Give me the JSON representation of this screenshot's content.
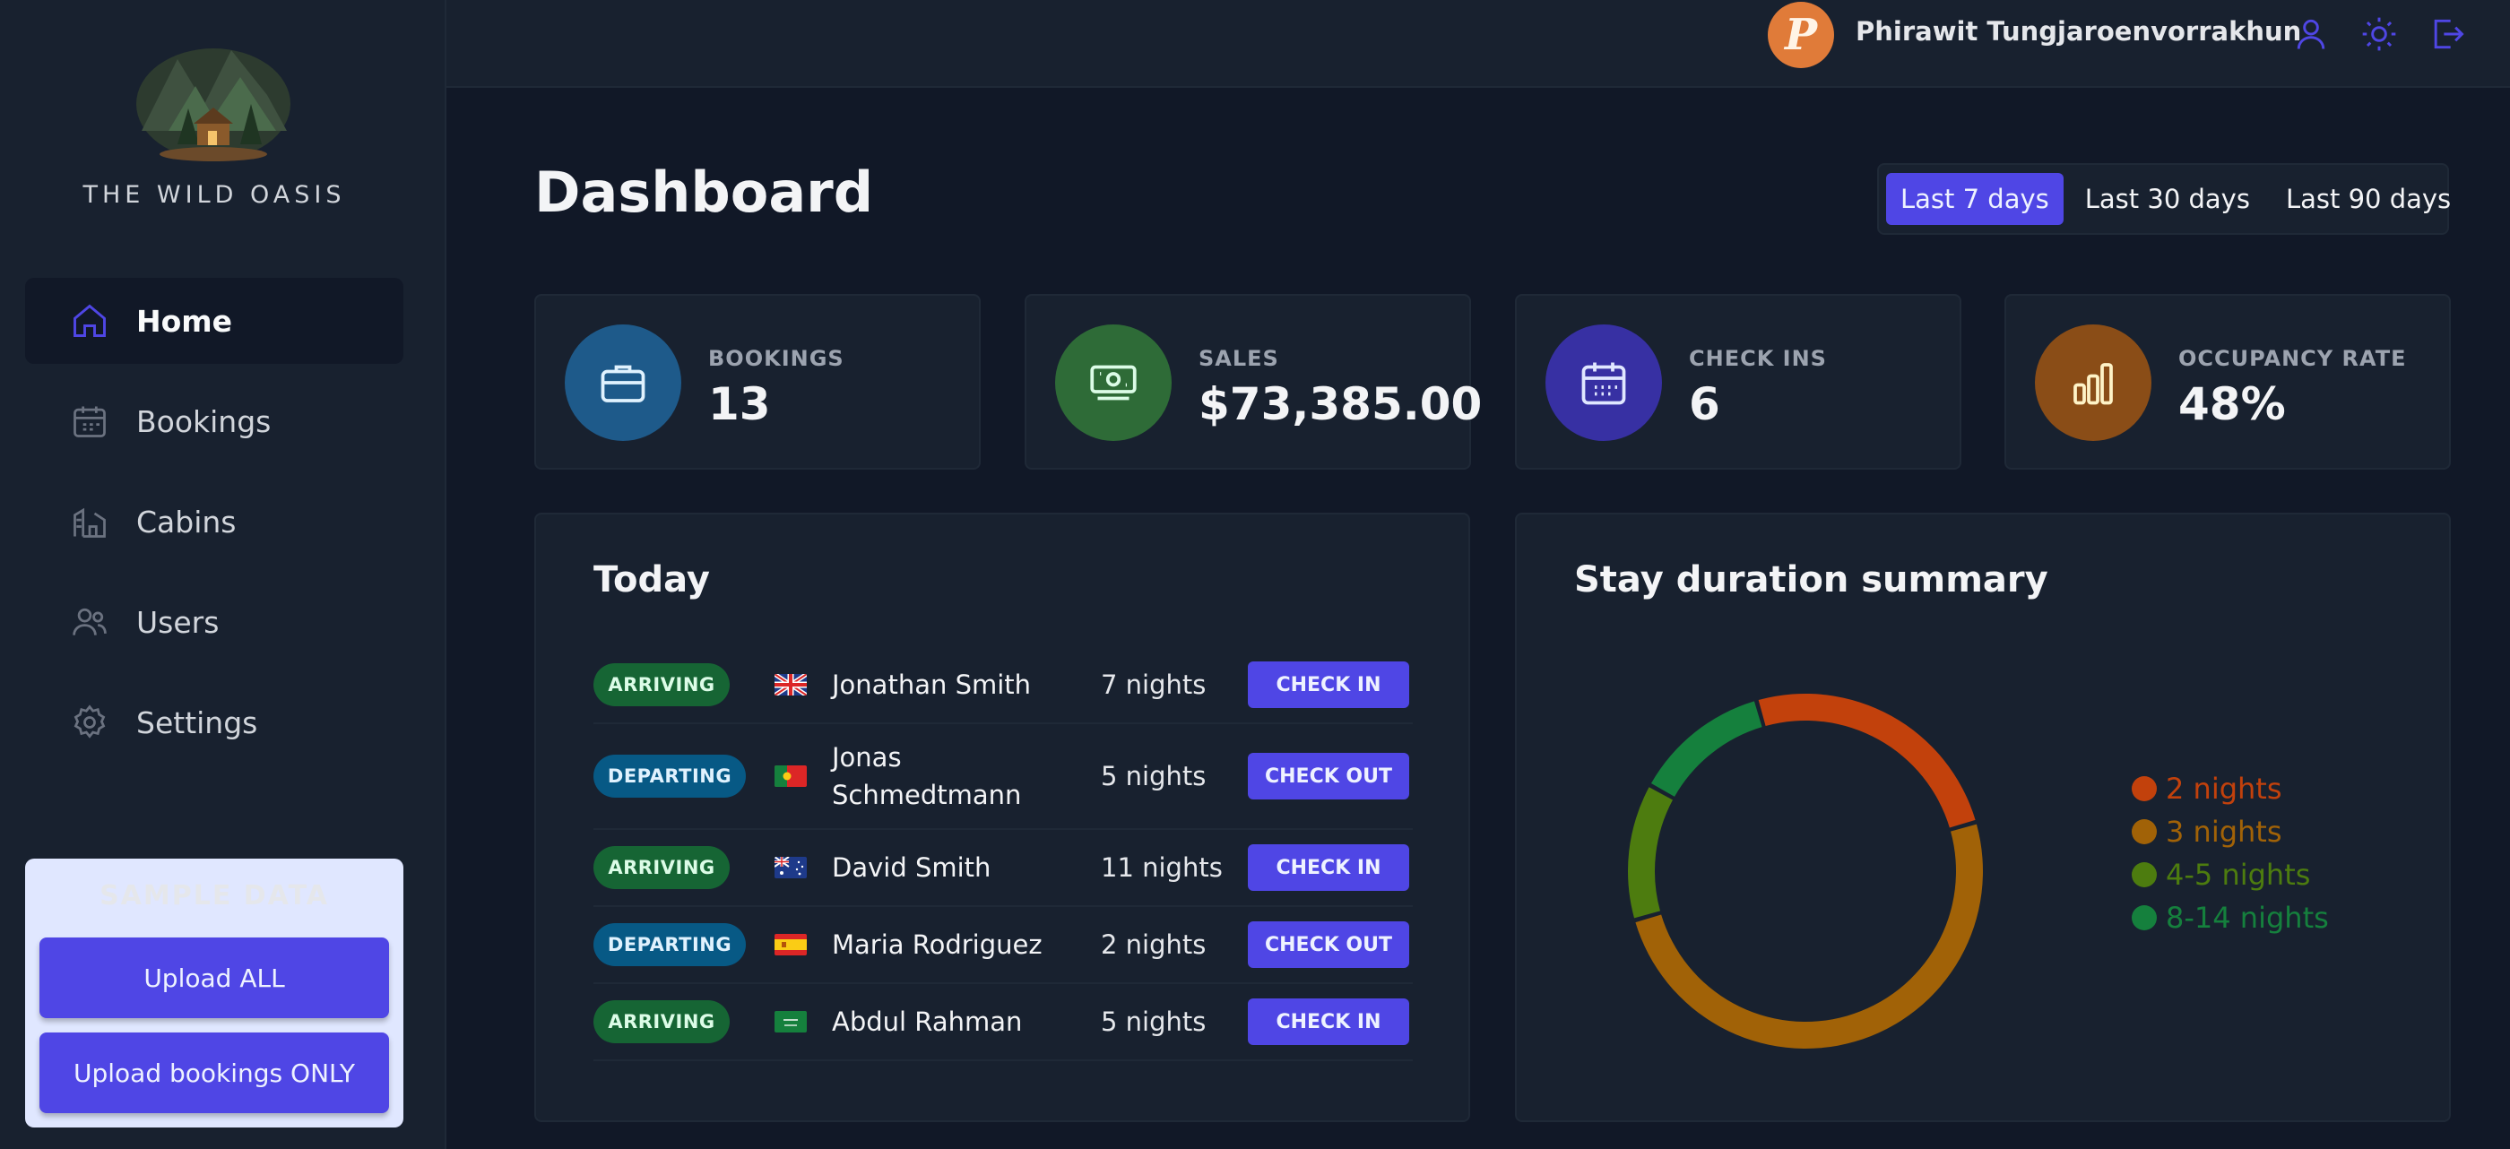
{
  "brand": {
    "name": "THE WILD OASIS"
  },
  "sidebar": {
    "items": [
      {
        "label": "Home",
        "icon": "home-icon",
        "active": true
      },
      {
        "label": "Bookings",
        "icon": "calendar-icon"
      },
      {
        "label": "Cabins",
        "icon": "cabin-icon"
      },
      {
        "label": "Users",
        "icon": "users-icon"
      },
      {
        "label": "Settings",
        "icon": "gear-icon"
      }
    ],
    "sample_data": {
      "title": "SAMPLE DATA",
      "upload_all": "Upload ALL",
      "upload_bookings": "Upload bookings ONLY"
    }
  },
  "header": {
    "avatar_letter": "P",
    "user_name": "Phirawit Tungjaroenvorrakhun",
    "icons": [
      "user-icon",
      "sun-icon",
      "logout-icon"
    ]
  },
  "main": {
    "title": "Dashboard",
    "filters": [
      {
        "label": "Last 7 days",
        "active": true
      },
      {
        "label": "Last 30 days"
      },
      {
        "label": "Last 90 days"
      }
    ],
    "stats": [
      {
        "label": "BOOKINGS",
        "value": "13",
        "color": "#1e5a8a",
        "icon": "briefcase-icon"
      },
      {
        "label": "SALES",
        "value": "$73,385.00",
        "color": "#2e6b37",
        "icon": "money-icon"
      },
      {
        "label": "CHECK INS",
        "value": "6",
        "color": "#3730a3",
        "icon": "calendar-icon"
      },
      {
        "label": "OCCUPANCY RATE",
        "value": "48%",
        "color": "#8a4d17",
        "icon": "chart-bar-icon"
      }
    ],
    "today": {
      "title": "Today",
      "rows": [
        {
          "status": "ARRIVING",
          "flag": "uk",
          "guest": "Jonathan Smith",
          "nights": "7 nights",
          "action": "CHECK IN"
        },
        {
          "status": "DEPARTING",
          "flag": "pt",
          "guest": "Jonas Schmedtmann",
          "nights": "5 nights",
          "action": "CHECK OUT"
        },
        {
          "status": "ARRIVING",
          "flag": "au",
          "guest": "David Smith",
          "nights": "11 nights",
          "action": "CHECK IN"
        },
        {
          "status": "DEPARTING",
          "flag": "es",
          "guest": "Maria Rodriguez",
          "nights": "2 nights",
          "action": "CHECK OUT"
        },
        {
          "status": "ARRIVING",
          "flag": "sa",
          "guest": "Abdul Rahman",
          "nights": "5 nights",
          "action": "CHECK IN"
        }
      ]
    },
    "stay_summary": {
      "title": "Stay duration summary"
    }
  },
  "chart_data": {
    "type": "pie",
    "title": "Stay duration summary",
    "categories": [
      "2 nights",
      "3 nights",
      "4-5 nights",
      "8-14 nights"
    ],
    "values": [
      2,
      4,
      1,
      1
    ],
    "colors": [
      "#c2410c",
      "#a16207",
      "#4d7c0f",
      "#15803d"
    ],
    "legend": "right"
  },
  "colors": {
    "accent": "#4f46e5",
    "background": "#111827",
    "surface": "#18212f"
  }
}
